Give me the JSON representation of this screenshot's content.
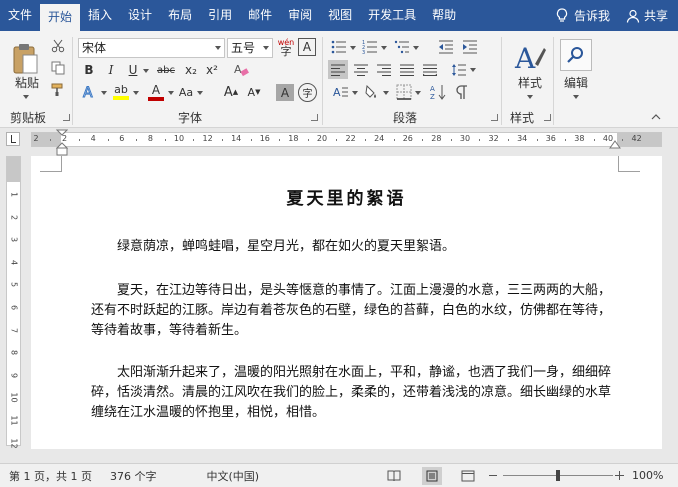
{
  "menu": {
    "tabs": [
      {
        "label": "文件"
      },
      {
        "label": "开始"
      },
      {
        "label": "插入"
      },
      {
        "label": "设计"
      },
      {
        "label": "布局"
      },
      {
        "label": "引用"
      },
      {
        "label": "邮件"
      },
      {
        "label": "审阅"
      },
      {
        "label": "视图"
      },
      {
        "label": "开发工具"
      },
      {
        "label": "帮助"
      }
    ],
    "active_tab": "开始",
    "tell_me": "告诉我",
    "share": "共享"
  },
  "ribbon": {
    "clipboard": {
      "label": "剪贴板",
      "paste_label": "粘贴"
    },
    "font": {
      "label": "字体",
      "font_name": "宋体",
      "font_size": "五号",
      "wen_label": "wén",
      "bold": "B",
      "italic": "I",
      "underline": "U",
      "strikethrough": "abc",
      "subscript": "x₂",
      "superscript": "x²",
      "font_color_letter": "A",
      "highlight_letter": "ab",
      "grow": "A",
      "shrink": "A",
      "case": "Aa",
      "char_shading": "A",
      "enclose": "字",
      "highlight_color": "#ffff00",
      "font_color": "#c00000"
    },
    "paragraph": {
      "label": "段落"
    },
    "styles": {
      "label": "样式",
      "button_label": "样式"
    },
    "editing": {
      "label": "编辑",
      "button_label": "编辑"
    }
  },
  "ruler": {
    "h_ticks": [
      "2",
      "2",
      "4",
      "6",
      "8",
      "10",
      "12",
      "14",
      "16",
      "18",
      "20",
      "22",
      "24",
      "26",
      "28",
      "30",
      "32",
      "34",
      "36",
      "38",
      "40",
      "42"
    ],
    "v_ticks": [
      "1",
      "2",
      "3",
      "4",
      "5",
      "6",
      "7",
      "8",
      "9",
      "10",
      "11",
      "12"
    ]
  },
  "document": {
    "title": "夏天里的絮语",
    "paragraphs": [
      "绿意荫凉，蝉鸣蛙唱，星空月光，都在如火的夏天里絮语。",
      "夏天，在江边等待日出，是头等惬意的事情了。江面上漫漫的水意，三三两两的大船，还有不时跃起的江豚。岸边有着苍灰色的石壁，绿色的苔藓，白色的水纹，仿佛都在等待，等待着故事，等待着新生。",
      "太阳渐渐升起来了，温暖的阳光照射在水面上，平和，静谧，也洒了我们一身，细细碎碎，恬淡清然。清晨的江风吹在我们的脸上，柔柔的，还带着浅浅的凉意。细长幽绿的水草缠绕在江水温暖的怀抱里，相悦，相惜。"
    ]
  },
  "status": {
    "page": "第 1 页，共 1 页",
    "words": "376 个字",
    "language": "中文(中国)",
    "zoom": "100%",
    "zoom_level": 1.0,
    "accent": "#2b579a"
  }
}
